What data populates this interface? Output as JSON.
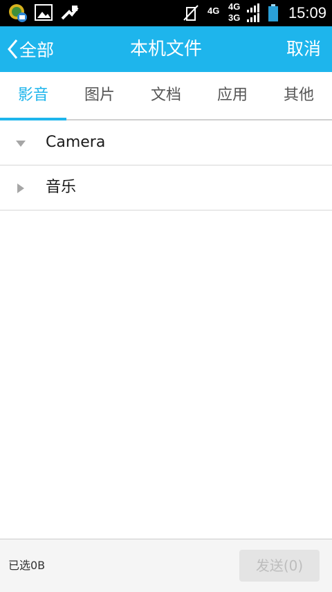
{
  "status_bar": {
    "time": "15:09",
    "network_1": "4G",
    "network_2a": "4G",
    "network_2b": "3G",
    "icons": [
      "app-notification-icon",
      "gallery-icon",
      "usb-debug-icon",
      "mute-icon",
      "signal-icon",
      "battery-icon"
    ]
  },
  "header": {
    "back_label": "全部",
    "title": "本机文件",
    "cancel_label": "取消"
  },
  "tabs": [
    {
      "label": "影音",
      "active": true
    },
    {
      "label": "图片",
      "active": false
    },
    {
      "label": "文档",
      "active": false
    },
    {
      "label": "应用",
      "active": false
    },
    {
      "label": "其他",
      "active": false
    }
  ],
  "folders": [
    {
      "name": "Camera",
      "expanded": true
    },
    {
      "name": "音乐",
      "expanded": false
    }
  ],
  "footer": {
    "selected_label": "已选0B",
    "send_label": "发送(0)"
  },
  "colors": {
    "accent": "#1eb5ec",
    "status_bar": "#000000",
    "footer_bg": "#f5f5f5"
  }
}
